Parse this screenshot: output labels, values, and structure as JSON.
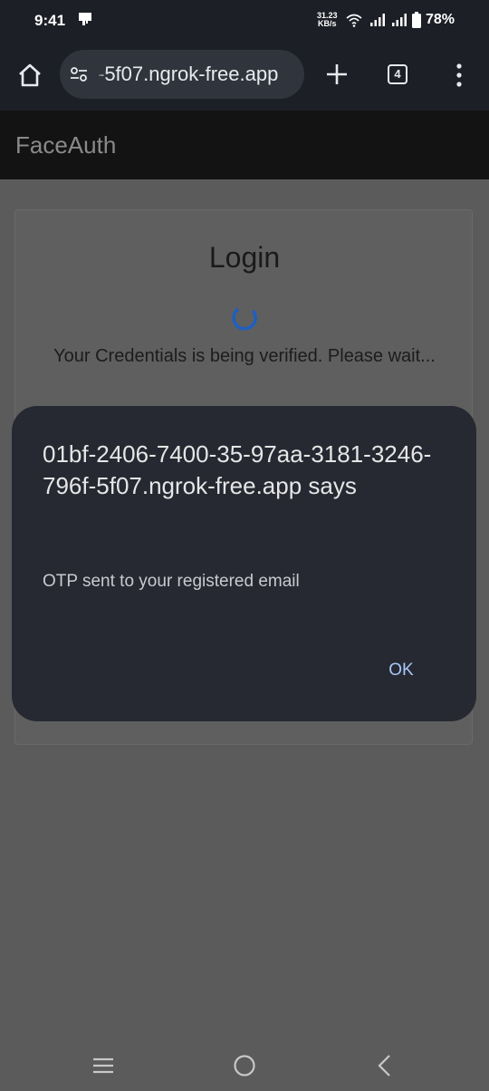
{
  "status_bar": {
    "time": "9:41",
    "network_speed_value": "31.23",
    "network_speed_unit": "KB/s",
    "battery_percent": "78%",
    "icons": [
      "notification-icon",
      "wifi-icon",
      "signal-icon",
      "signal-icon",
      "battery-icon"
    ]
  },
  "browser": {
    "url": "-5f07.ngrok-free.app",
    "tab_count": "4",
    "icons": [
      "home-icon",
      "tune-icon",
      "plus-icon",
      "tabs-icon",
      "more-vert-icon"
    ]
  },
  "app": {
    "title": "FaceAuth"
  },
  "login": {
    "heading": "Login",
    "status_message": "Your Credentials is being verified. Please wait..."
  },
  "dialog": {
    "title": "01bf-2406-7400-35-97aa-3181-3246-796f-5f07.ngrok-free.app says",
    "message": "OTP sent to your registered email",
    "ok_label": "OK"
  },
  "nav_bar": {
    "icons": [
      "recents-icon",
      "home-circle-icon",
      "back-icon"
    ]
  },
  "colors": {
    "browser_chrome": "#1c1f25",
    "url_pill": "#30353d",
    "dialog_bg": "#262932",
    "dialog_button": "#a8c7fa",
    "spinner": "#1f5fbf",
    "scrim_bg": "#5b5b5b"
  }
}
